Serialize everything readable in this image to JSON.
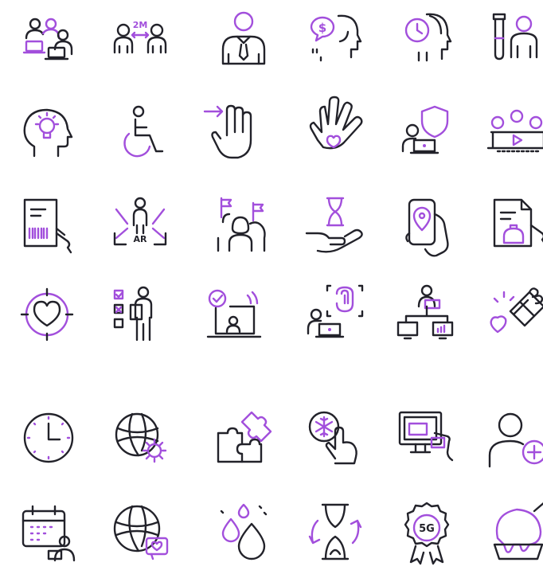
{
  "colors": {
    "line": "#22222a",
    "accent": "#a24fdc",
    "background": "#ffffff"
  },
  "icons": [
    {
      "name": "group-work-icon"
    },
    {
      "name": "social-distance-icon",
      "label": "2M"
    },
    {
      "name": "business-person-icon"
    },
    {
      "name": "money-thinking-icon",
      "symbol": "$"
    },
    {
      "name": "time-management-icon"
    },
    {
      "name": "lab-test-person-icon"
    },
    {
      "name": "idea-head-icon"
    },
    {
      "name": "wheelchair-icon"
    },
    {
      "name": "three-finger-swipe-icon"
    },
    {
      "name": "hand-heart-icon"
    },
    {
      "name": "security-laptop-icon"
    },
    {
      "name": "video-conference-icon"
    },
    {
      "name": "barcode-document-icon"
    },
    {
      "name": "augmented-reality-icon",
      "label": "AR"
    },
    {
      "name": "women-leaders-icon"
    },
    {
      "name": "hourglass-hand-icon"
    },
    {
      "name": "phone-location-icon"
    },
    {
      "name": "construction-document-icon"
    },
    {
      "name": "heart-target-icon"
    },
    {
      "name": "checklist-person-icon"
    },
    {
      "name": "online-approval-icon"
    },
    {
      "name": "fingerprint-laptop-icon"
    },
    {
      "name": "remote-teamwork-icon"
    },
    {
      "name": "gift-heart-icon"
    },
    {
      "name": "clock-icon"
    },
    {
      "name": "globe-settings-icon"
    },
    {
      "name": "puzzle-icon"
    },
    {
      "name": "snowflake-touch-icon"
    },
    {
      "name": "online-payment-card-icon"
    },
    {
      "name": "add-user-icon"
    },
    {
      "name": "calendar-person-icon"
    },
    {
      "name": "globe-heart-chat-icon"
    },
    {
      "name": "water-drops-icon"
    },
    {
      "name": "hourglass-refresh-icon"
    },
    {
      "name": "5g-award-icon",
      "label": "5G"
    },
    {
      "name": "ice-cream-icon"
    }
  ]
}
